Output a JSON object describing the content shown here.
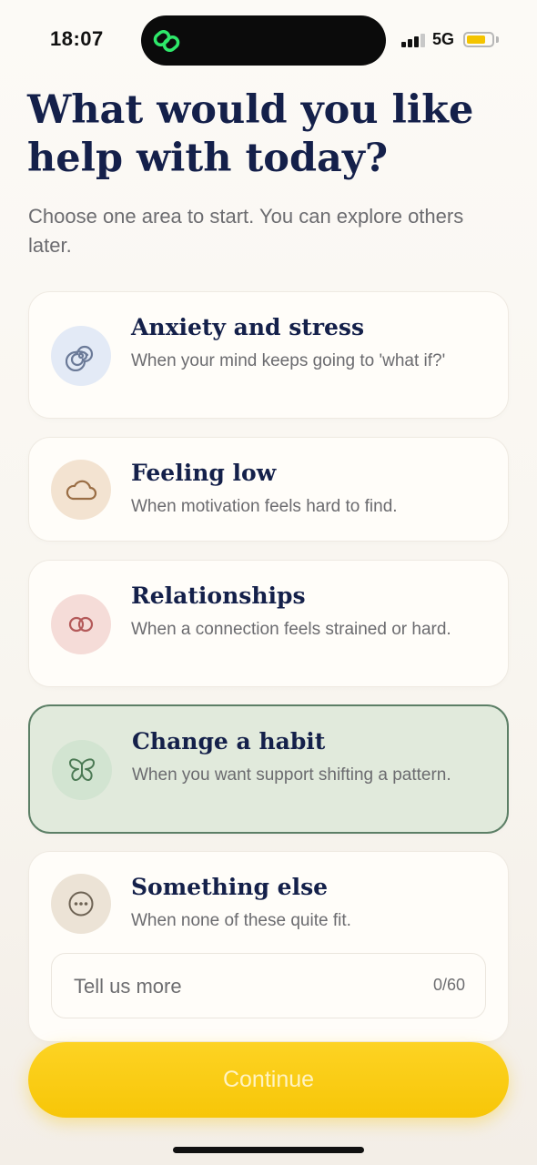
{
  "status_bar": {
    "time": "18:07",
    "network": "5G"
  },
  "header": {
    "title": "What would you like help with today?",
    "subtitle": "Choose one area to start. You can explore others later."
  },
  "options": [
    {
      "title": "Anxiety and stress",
      "description": "When your mind keeps going to 'what if?'",
      "icon": "spiral-icon",
      "selected": false
    },
    {
      "title": "Feeling low",
      "description": "When motivation feels hard to find.",
      "icon": "cloud-icon",
      "selected": false
    },
    {
      "title": "Relationships",
      "description": "When a connection feels strained or hard.",
      "icon": "interlocking-rings-icon",
      "selected": false
    },
    {
      "title": "Change a habit",
      "description": "When you want support shifting a pattern.",
      "icon": "butterfly-icon",
      "selected": true
    },
    {
      "title": "Something else",
      "description": "When none of these quite fit.",
      "icon": "ellipsis-icon",
      "selected": false
    }
  ],
  "more_input": {
    "placeholder": "Tell us more",
    "counter": "0/60"
  },
  "continue_label": "Continue",
  "colors": {
    "accent_yellow": "#f9cb10",
    "selected_border": "#5c7f66",
    "selected_bg": "#e1eadc",
    "title_navy": "#14204a"
  }
}
